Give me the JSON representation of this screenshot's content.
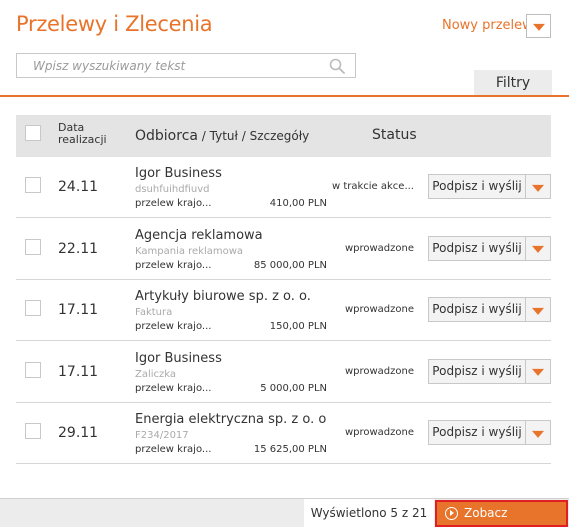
{
  "header": {
    "title": "Przelewy i Zlecenia",
    "new_transfer_label": "Nowy przelew"
  },
  "search": {
    "placeholder": "Wpisz wyszukiwany tekst"
  },
  "filters_label": "Filtry",
  "table": {
    "col_date_line1": "Data",
    "col_date_line2": "realizacji",
    "col_recipient": "Odbiorca",
    "col_recipient_sub": " / Tytuł / Szczegóły",
    "col_status": "Status",
    "rows": [
      {
        "date": "24.11",
        "recipient": "Igor Business",
        "subtitle": "dsuhfuihdfiuvd",
        "type": "przelew krajo...",
        "amount": "410,00 PLN",
        "status": "w trakcie akce...",
        "action": "Podpisz i wyślij"
      },
      {
        "date": "22.11",
        "recipient": "Agencja reklamowa",
        "subtitle": "Kampania reklamowa",
        "type": "przelew krajo...",
        "amount": "85 000,00 PLN",
        "status": "wprowadzone",
        "action": "Podpisz i wyślij"
      },
      {
        "date": "17.11",
        "recipient": "Artykuły biurowe sp. z o. o.",
        "subtitle": "Faktura",
        "type": "przelew krajo...",
        "amount": "150,00 PLN",
        "status": "wprowadzone",
        "action": "Podpisz i wyślij"
      },
      {
        "date": "17.11",
        "recipient": "Igor Business",
        "subtitle": "Zaliczka",
        "type": "przelew krajo...",
        "amount": "5 000,00 PLN",
        "status": "wprowadzone",
        "action": "Podpisz i wyślij"
      },
      {
        "date": "29.11",
        "recipient": "Energia elektryczna sp. z o. o",
        "subtitle": "F234/2017",
        "type": "przelew krajo...",
        "amount": "15 625,00 PLN",
        "status": "wprowadzone",
        "action": "Podpisz i wyślij"
      }
    ]
  },
  "footer": {
    "count_label": "Wyświetlono 5 z 21",
    "see_all_label": "Zobacz wszystkie"
  },
  "colors": {
    "accent": "#e8732a",
    "highlight_border": "#e02020"
  },
  "icons": {
    "search": "search-icon",
    "dropdown": "chevron-down-icon",
    "see_all": "play-circle-icon"
  }
}
